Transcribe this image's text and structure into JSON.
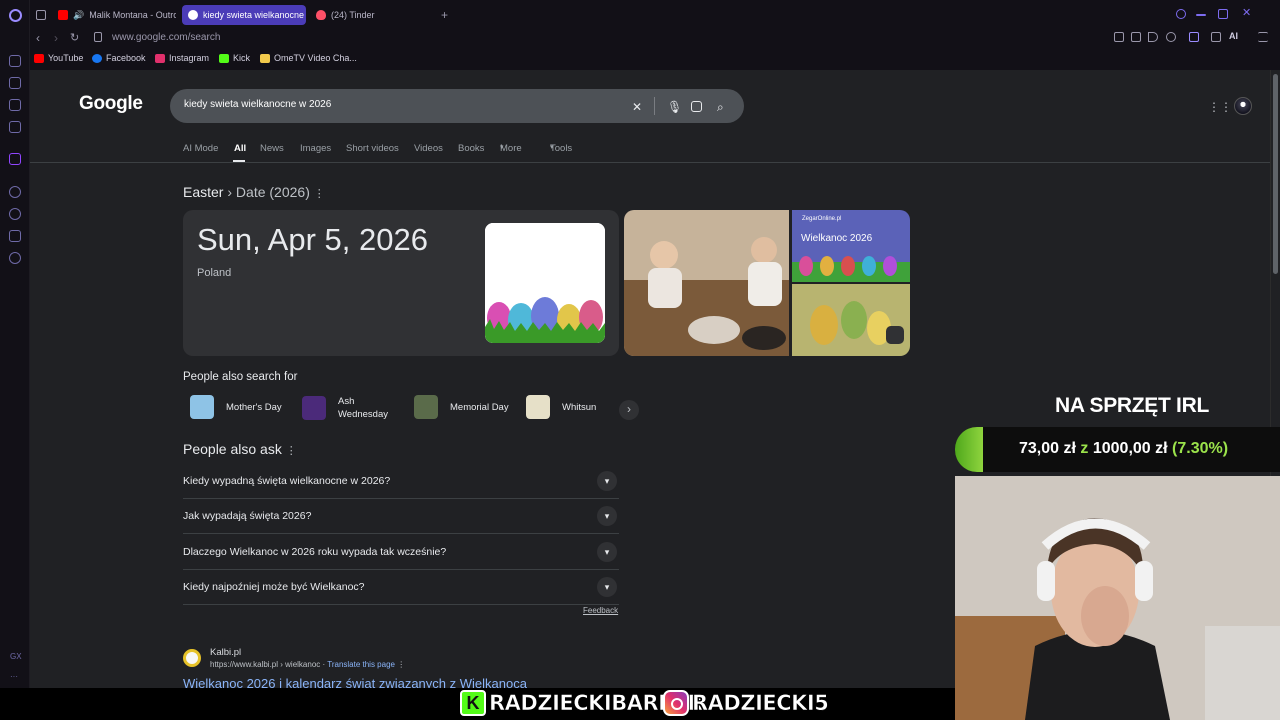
{
  "browser": {
    "tabs": [
      {
        "label": "Malik Montana - Outro",
        "favicon_color": "#ff0000"
      },
      {
        "label": "kiedy swieta wielkanocne",
        "favicon_color": "#ffffff"
      },
      {
        "label": "(24) Tinder",
        "favicon_color": "#fd5068"
      }
    ],
    "new_tab_label": "+",
    "url": "www.google.com/search",
    "ai_label": "AI",
    "bookmarks": [
      {
        "label": "YouTube",
        "color": "#ff0000"
      },
      {
        "label": "Facebook",
        "color": "#1877f2"
      },
      {
        "label": "Instagram",
        "color": "#e1306c"
      },
      {
        "label": "Kick",
        "color": "#53fc18"
      },
      {
        "label": "OmeTV Video Cha...",
        "color": "#f2c94c"
      }
    ],
    "sidebar_bottom_label": "GX"
  },
  "google": {
    "logo_text": "Google",
    "search_query": "kiedy swieta wielkanocne w 2026",
    "tabs": [
      "AI Mode",
      "News",
      "Images",
      "Short videos",
      "Videos",
      "Books",
      "More",
      "Tools"
    ],
    "selected_tab": "All",
    "answer": {
      "heading_subject": "Easter",
      "heading_detail": "Date (2026)",
      "date": "Sun, Apr 5, 2026",
      "location": "Poland",
      "image_caption_site": "ZegarOnline.pl",
      "image_caption_title": "Wielkanoc 2026"
    },
    "people_also_search_title": "People also search for",
    "people_also_search": [
      {
        "label": "Mother's Day"
      },
      {
        "label": "Ash Wednesday",
        "line1": "Ash",
        "line2": "Wednesday"
      },
      {
        "label": "Memorial Day"
      },
      {
        "label": "Whitsun"
      }
    ],
    "people_also_ask_title": "People also ask",
    "people_also_ask": [
      "Kiedy wypadną święta wielkanocne w 2026?",
      "Jak wypadają święta 2026?",
      "Dlaczego Wielkanoc w 2026 roku wypada tak wcześnie?",
      "Kiedy najpoźniej może być Wielkanoc?"
    ],
    "feedback": "Feedback",
    "result": {
      "site": "Kalbi.pl",
      "url": "https://www.kalbi.pl › wielkanoc",
      "translate": "Translate this page",
      "title": "Wielkanoc 2026 i kalendarz świąt związanych z Wielkanocą"
    }
  },
  "overlay": {
    "goal_title": "NA SPRZĘT IRL",
    "goal_current": "73,00 zł",
    "goal_connector": "z",
    "goal_target": "1000,00 zł",
    "goal_percent_label": "(7.30%)",
    "goal_fraction": 0.073,
    "kick_handle": "RADZIECKIBARBER",
    "instagram_handle": "RADZIECKI5"
  }
}
